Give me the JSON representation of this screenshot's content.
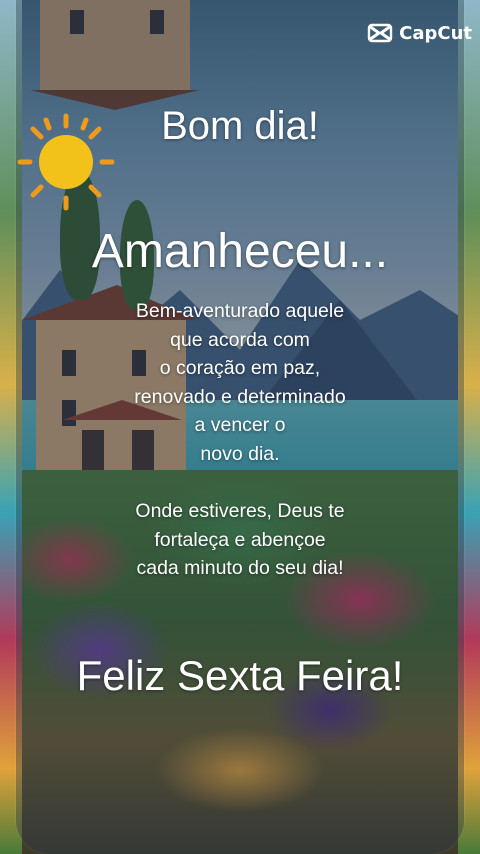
{
  "watermark": {
    "brand": "CapCut",
    "icon": "capcut-logo-icon",
    "color": "#ffffff"
  },
  "decoration": {
    "icon": "sun-icon",
    "sun_color": "#f2c21b",
    "ray_color": "#ee9a1a"
  },
  "message": {
    "greeting": "Bom dia!",
    "headline": "Amanheceu...",
    "body": "Bem-aventurado aquele\nque acorda com\no coração em paz,\nrenovado e determinado\na vencer o\nnovo dia.",
    "blessing": "Onde estiveres, Deus te\nfortaleça e abençoe\ncada minuto do seu dia!",
    "closing": "Feliz Sexta Feira!"
  }
}
